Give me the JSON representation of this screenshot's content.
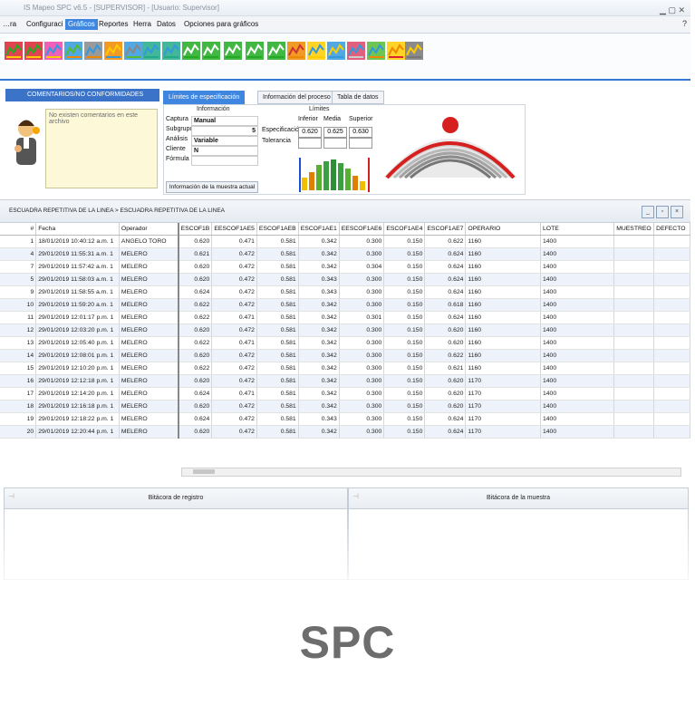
{
  "window": {
    "title": "IS Mapeo SPC v6.5 - [SUPERVISOR] - [Usuario: Supervisor]"
  },
  "menu": {
    "items": [
      "…ra",
      "Configuraci",
      "Gráficos",
      "Reportes",
      "Herra",
      "Datos",
      "Opciones para gráficos"
    ],
    "active_index": 2,
    "right": "?"
  },
  "toolbar": {
    "icons": [
      "xbar-r-chart-icon",
      "xbar-s-chart-icon",
      "flow-chart-icon",
      "pareto-icon",
      "trend-icon",
      "histogram-icon",
      "bar-chart-icon",
      "table-grid-icon",
      "table-grid-icon",
      "control-chart-icon",
      "control-chart-icon",
      "control-chart-icon",
      "control-chart-icon",
      "control-chart-icon",
      "distribution-icon",
      "capability-icon",
      "run-chart-icon",
      "pie-icon",
      "multi-chart-icon",
      "gauge-icon",
      "summary-icon"
    ]
  },
  "comments": {
    "header": "COMENTARIOS/NO CONFORMIDADES",
    "placeholder": "No existen comentarios en este archivo"
  },
  "tabs": [
    {
      "label": "Límites de especificación",
      "active": true
    },
    {
      "label": "Información del proceso",
      "active": false
    },
    {
      "label": "Tabla de datos",
      "active": false
    }
  ],
  "info": {
    "section_title": "Información",
    "limits_title": "Límites",
    "rows": [
      {
        "label": "Captura",
        "value": "Manual"
      },
      {
        "label": "Subgrupo",
        "value": "5"
      },
      {
        "label": "Análisis",
        "value": "Variable"
      },
      {
        "label": "Cliente",
        "value": "N"
      },
      {
        "label": "Fórmula",
        "value": ""
      }
    ],
    "limits_cols": [
      "Inferior",
      "Media",
      "Superior"
    ],
    "limits_rows": [
      {
        "label": "Especificación",
        "values": [
          "0.620",
          "0.625",
          "0.630"
        ]
      },
      {
        "label": "Tolerancia",
        "values": [
          "",
          "",
          ""
        ]
      }
    ],
    "graph_link": "Información de la muestra actual"
  },
  "grid": {
    "caption": "ESCUADRA REPETITIVA DE LA LINEA > ESCUADRA REPETITIVA DE LA LINEA",
    "columns": [
      "#",
      "Fecha",
      "Operador",
      "ESCOF1B",
      "EESCOF1AE5",
      "ESCOF1AEB",
      "ESCOF1AE1",
      "EESCOF1AE6",
      "ESCOF1AE4",
      "ESCOF1AE7",
      "OPERARIO",
      "LOTE",
      "MUESTREO",
      "DEFECTO"
    ],
    "rows": [
      [
        "1",
        "18/01/2019 10:40:12 a.m. 1",
        "ANGELO TORO",
        "0.620",
        "0.471",
        "0.581",
        "0.342",
        "0.300",
        "0.150",
        "0.622",
        "1160",
        "1400",
        "",
        ""
      ],
      [
        "4",
        "29/01/2019 11:55:31 a.m. 1",
        "MELERO",
        "0.621",
        "0.472",
        "0.581",
        "0.342",
        "0.300",
        "0.150",
        "0.624",
        "1160",
        "1400",
        "",
        ""
      ],
      [
        "7",
        "29/01/2019 11:57:42 a.m. 1",
        "MELERO",
        "0.620",
        "0.472",
        "0.581",
        "0.342",
        "0.304",
        "0.150",
        "0.624",
        "1160",
        "1400",
        "",
        ""
      ],
      [
        "5",
        "29/01/2019 11:58:03 a.m. 1",
        "MELERO",
        "0.620",
        "0.472",
        "0.581",
        "0.343",
        "0.300",
        "0.150",
        "0.624",
        "1160",
        "1400",
        "",
        ""
      ],
      [
        "9",
        "29/01/2019 11:58:55 a.m. 1",
        "MELERO",
        "0.624",
        "0.472",
        "0.581",
        "0.343",
        "0.300",
        "0.150",
        "0.624",
        "1160",
        "1400",
        "",
        ""
      ],
      [
        "10",
        "29/01/2019 11:59:20 a.m. 1",
        "MELERO",
        "0.622",
        "0.472",
        "0.581",
        "0.342",
        "0.300",
        "0.150",
        "0.618",
        "1160",
        "1400",
        "",
        ""
      ],
      [
        "11",
        "29/01/2019 12:01:17 p.m. 1",
        "MELERO",
        "0.622",
        "0.471",
        "0.581",
        "0.342",
        "0.301",
        "0.150",
        "0.624",
        "1160",
        "1400",
        "",
        ""
      ],
      [
        "12",
        "29/01/2019 12:03:20 p.m. 1",
        "MELERO",
        "0.620",
        "0.472",
        "0.581",
        "0.342",
        "0.300",
        "0.150",
        "0.620",
        "1160",
        "1400",
        "",
        ""
      ],
      [
        "13",
        "29/01/2019 12:05:40 p.m. 1",
        "MELERO",
        "0.622",
        "0.471",
        "0.581",
        "0.342",
        "0.300",
        "0.150",
        "0.620",
        "1160",
        "1400",
        "",
        ""
      ],
      [
        "14",
        "29/01/2019 12:08:01 p.m. 1",
        "MELERO",
        "0.620",
        "0.472",
        "0.581",
        "0.342",
        "0.300",
        "0.150",
        "0.622",
        "1160",
        "1400",
        "",
        ""
      ],
      [
        "15",
        "29/01/2019 12:10:20 p.m. 1",
        "MELERO",
        "0.622",
        "0.472",
        "0.581",
        "0.342",
        "0.300",
        "0.150",
        "0.621",
        "1160",
        "1400",
        "",
        ""
      ],
      [
        "16",
        "29/01/2019 12:12:18 p.m. 1",
        "MELERO",
        "0.620",
        "0.472",
        "0.581",
        "0.342",
        "0.300",
        "0.150",
        "0.620",
        "1170",
        "1400",
        "",
        ""
      ],
      [
        "17",
        "29/01/2019 12:14:20 p.m. 1",
        "MELERO",
        "0.624",
        "0.471",
        "0.581",
        "0.342",
        "0.300",
        "0.150",
        "0.620",
        "1170",
        "1400",
        "",
        ""
      ],
      [
        "18",
        "29/01/2019 12:16:18 p.m. 1",
        "MELERO",
        "0.620",
        "0.472",
        "0.581",
        "0.342",
        "0.300",
        "0.150",
        "0.620",
        "1170",
        "1400",
        "",
        ""
      ],
      [
        "19",
        "29/01/2019 12:18:22 p.m. 1",
        "MELERO",
        "0.624",
        "0.472",
        "0.581",
        "0.343",
        "0.300",
        "0.150",
        "0.624",
        "1170",
        "1400",
        "",
        ""
      ],
      [
        "20",
        "29/01/2019 12:20:44 p.m. 1",
        "MELERO",
        "0.620",
        "0.472",
        "0.581",
        "0.342",
        "0.300",
        "0.150",
        "0.624",
        "1170",
        "1400",
        "",
        ""
      ]
    ]
  },
  "bottom": {
    "left_title": "Bitácora de registro",
    "right_title": "Bitácora de la muestra"
  },
  "caption": "SPC",
  "colors": {
    "accent": "#3f86e0",
    "green": "#2f9a2f",
    "bell_red": "#d62020"
  }
}
